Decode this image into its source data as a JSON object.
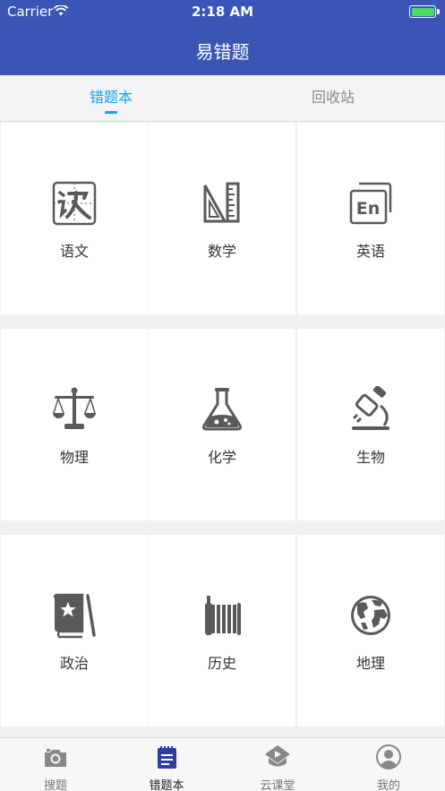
{
  "status_bar": {
    "carrier": "Carrier",
    "time": "2:18 AM"
  },
  "header": {
    "title": "易错题"
  },
  "tabs": [
    {
      "label": "错题本",
      "active": true
    },
    {
      "label": "回收站",
      "active": false
    }
  ],
  "subjects": [
    {
      "label": "语文",
      "icon": "chinese-icon"
    },
    {
      "label": "数学",
      "icon": "math-icon"
    },
    {
      "label": "英语",
      "icon": "english-icon"
    },
    {
      "label": "物理",
      "icon": "physics-scale-icon"
    },
    {
      "label": "化学",
      "icon": "chemistry-flask-icon"
    },
    {
      "label": "生物",
      "icon": "biology-microscope-icon"
    },
    {
      "label": "政治",
      "icon": "politics-book-icon"
    },
    {
      "label": "历史",
      "icon": "history-scroll-icon"
    },
    {
      "label": "地理",
      "icon": "geography-globe-icon"
    }
  ],
  "bottom_nav": [
    {
      "label": "搜题",
      "icon": "camera-icon",
      "active": false
    },
    {
      "label": "错题本",
      "icon": "notebook-icon",
      "active": true
    },
    {
      "label": "云课堂",
      "icon": "cloud-class-icon",
      "active": false
    },
    {
      "label": "我的",
      "icon": "profile-icon",
      "active": false
    }
  ],
  "colors": {
    "header": "#3b55b6",
    "accent": "#1aa2e5",
    "icon": "#5a5a5a",
    "active_nav": "#2f3e9e"
  }
}
